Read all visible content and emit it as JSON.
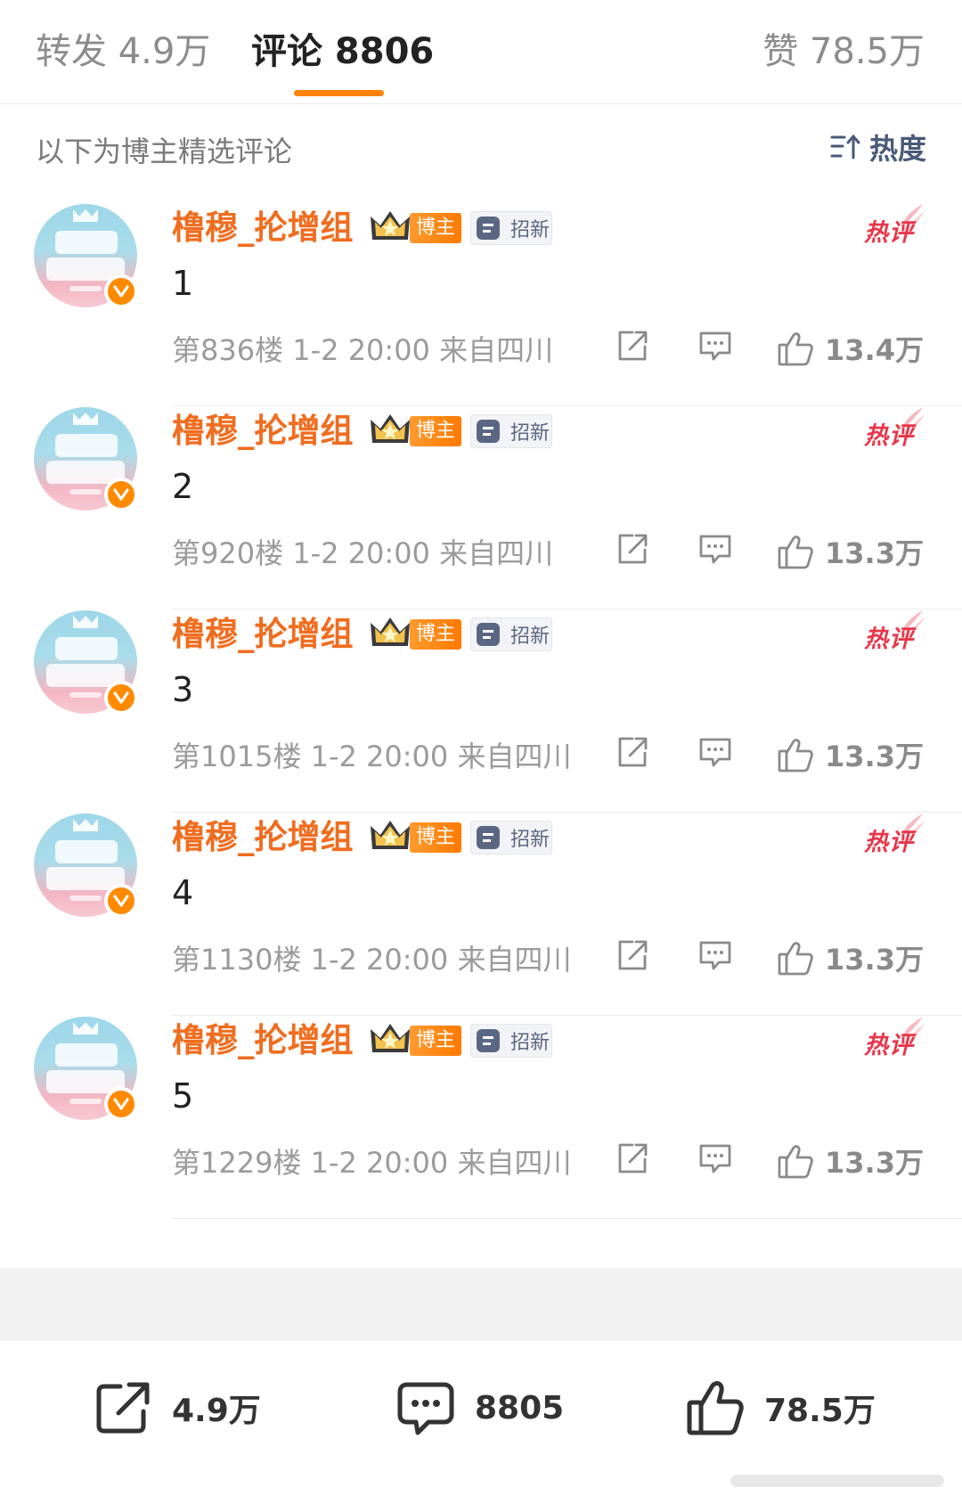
{
  "tabs": {
    "repost": "转发 4.9万",
    "comments": "评论 8806",
    "likes": "赞 78.5万",
    "active": "comments",
    "accent_color": "#ff8200"
  },
  "section": {
    "title": "以下为博主精选评论",
    "sort_label": "热度",
    "sort_icon": "sort-icon"
  },
  "badges": {
    "blogger": "博主",
    "recruit": "招新",
    "hot": "热评"
  },
  "comments": [
    {
      "username": "橹穆_抡增组",
      "text": "1",
      "meta": "第836楼 1-2 20:00 来自四川",
      "likes": "13.4万"
    },
    {
      "username": "橹穆_抡增组",
      "text": "2",
      "meta": "第920楼 1-2 20:00 来自四川",
      "likes": "13.3万"
    },
    {
      "username": "橹穆_抡增组",
      "text": "3",
      "meta": "第1015楼 1-2 20:00 来自四川",
      "likes": "13.3万"
    },
    {
      "username": "橹穆_抡增组",
      "text": "4",
      "meta": "第1130楼 1-2 20:00 来自四川",
      "likes": "13.3万"
    },
    {
      "username": "橹穆_抡增组",
      "text": "5",
      "meta": "第1229楼 1-2 20:00 来自四川",
      "likes": "13.3万"
    }
  ],
  "colors": {
    "username": "#f06d1f",
    "hot": "#e8364a",
    "sort": "#4a5a78"
  },
  "bottom_bar": {
    "share_count": "4.9万",
    "comment_count": "8805",
    "like_count": "78.5万"
  }
}
